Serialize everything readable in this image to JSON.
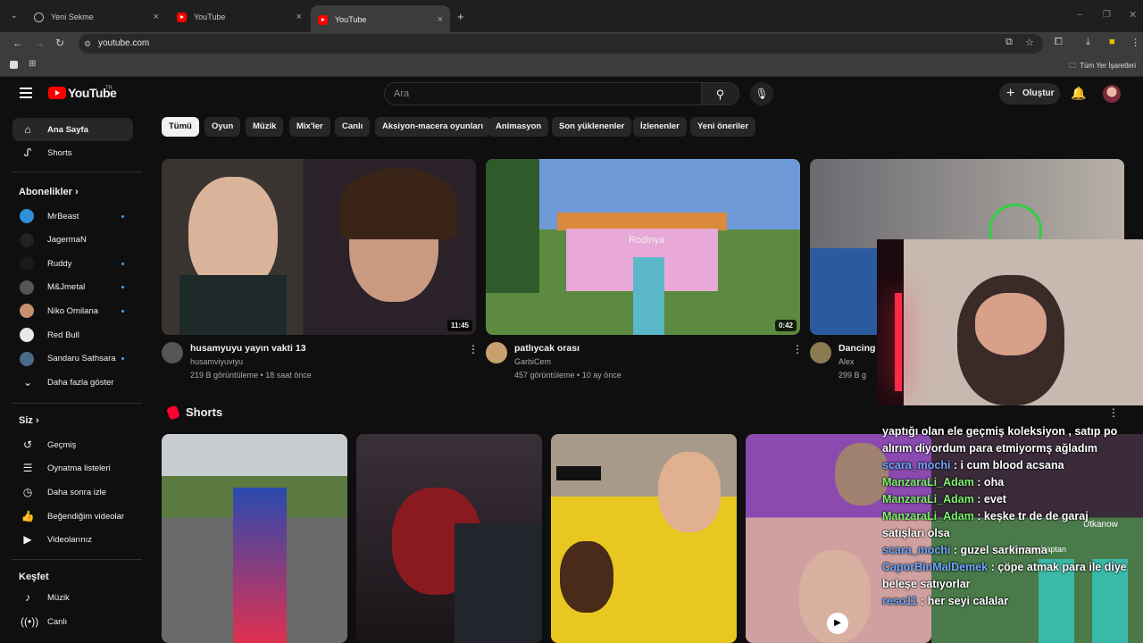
{
  "browser": {
    "tabs": [
      {
        "label": "Yeni Sekme"
      },
      {
        "label": "YouTube"
      },
      {
        "label": "YouTube"
      }
    ],
    "url": "youtube.com",
    "bookmarks_label": "Tüm Yer İşaretleri"
  },
  "masthead": {
    "logo_text": "YouTube",
    "country_code": "TR",
    "search_placeholder": "Ara",
    "create_label": "Oluştur"
  },
  "sidebar": {
    "main": [
      {
        "label": "Ana Sayfa",
        "icon": "home-icon"
      },
      {
        "label": "Shorts",
        "icon": "shorts-icon"
      }
    ],
    "subscriptions_title": "Abonelikler",
    "subscriptions": [
      {
        "label": "MrBeast",
        "new": true,
        "color": "#2f8fd8"
      },
      {
        "label": "JagermaN",
        "new": false,
        "color": "#222222"
      },
      {
        "label": "Ruddy",
        "new": true,
        "color": "#1a1a1a"
      },
      {
        "label": "M&Jmetal",
        "new": true,
        "color": "#555555"
      },
      {
        "label": "Niko Omilana",
        "new": true,
        "color": "#c89070"
      },
      {
        "label": "Red Bull",
        "new": false,
        "color": "#e8e8e8"
      },
      {
        "label": "Sandaru Sathsara",
        "new": true,
        "color": "#4a6a8a"
      }
    ],
    "show_more": "Daha fazla göster",
    "you_title": "Siz",
    "you": [
      {
        "label": "Geçmiş",
        "icon": "history-icon"
      },
      {
        "label": "Oynatma listeleri",
        "icon": "playlists-icon"
      },
      {
        "label": "Daha sonra izle",
        "icon": "watch-later-icon"
      },
      {
        "label": "Beğendiğim videolar",
        "icon": "like-icon"
      },
      {
        "label": "Videolarınız",
        "icon": "your-videos-icon"
      }
    ],
    "explore_title": "Keşfet",
    "explore": [
      {
        "label": "Müzik",
        "icon": "music-icon"
      },
      {
        "label": "Canlı",
        "icon": "live-icon"
      }
    ]
  },
  "chips": [
    "Tümü",
    "Oyun",
    "Müzik",
    "Mix'ler",
    "Canlı",
    "Aksiyon-macera oyunları",
    "Animasyon",
    "Son yüklenenler",
    "İzlenenler",
    "Yeni öneriler"
  ],
  "videos": [
    {
      "title": "husamyuyu yayın vakti 13",
      "channel": "husamviyuviyu",
      "meta": "219 B görüntüleme • 18 saat önce",
      "duration": "11:45"
    },
    {
      "title": "patlıycak orası",
      "channel": "GarbiCem",
      "meta": "457 görüntüleme • 10 ay önce",
      "duration": "0:42"
    },
    {
      "title": "Dancing T",
      "channel": "Alex",
      "meta": "299 B g"
    }
  ],
  "thumb_text": {
    "minecraft_sign": "Rodinya"
  },
  "shorts_title": "Shorts",
  "overlay_chat": [
    {
      "user": "",
      "text": "yaptığı olan ele geçmiş koleksiyon , satıp po"
    },
    {
      "user": "",
      "text": "alırım diyordum para etmiyormş ağladım"
    },
    {
      "user": "scara_mochi",
      "text": ": i cum blood acsana"
    },
    {
      "user": "ManzaraLi_Adam",
      "text": ": oha"
    },
    {
      "user": "ManzaraLi_Adam",
      "text": ": evet"
    },
    {
      "user": "ManzaraLi_Adam",
      "text": ": keşke tr de de garaj"
    },
    {
      "user": "",
      "text": "satışları olsa"
    },
    {
      "user": "scara_mochi",
      "text": ": guzel sarkinama"
    },
    {
      "user": "CaporBinMalDemek",
      "text": ": çöpe atmak para ile diye"
    },
    {
      "user": "",
      "text": "beleşe satıyorlar"
    },
    {
      "user": "reso11",
      "text": ": her seyi calalar"
    }
  ],
  "game_nametags": [
    "Utkanow",
    "Foyraz_Kaptan"
  ]
}
